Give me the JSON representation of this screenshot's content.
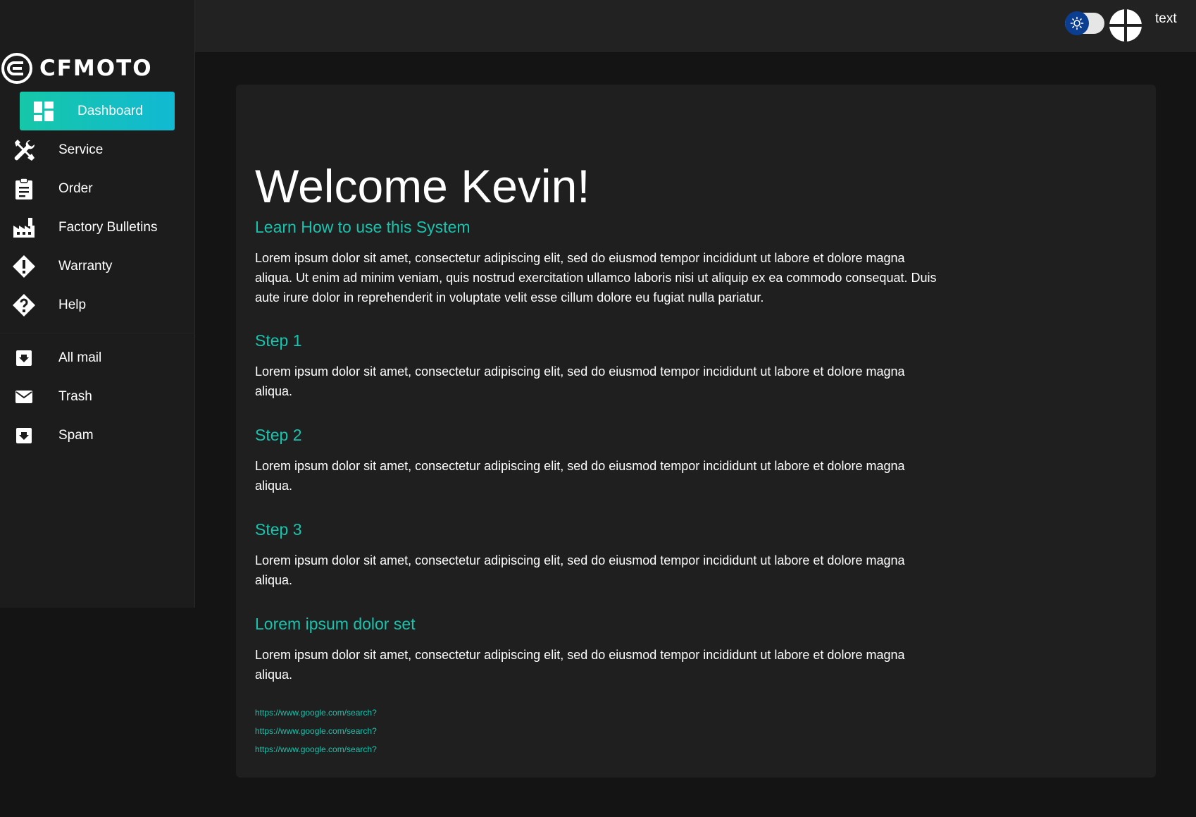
{
  "brand": {
    "name": "CFMOTO"
  },
  "sidebar": {
    "items": [
      {
        "label": "Dashboard",
        "icon": "dashboard-icon",
        "active": true
      },
      {
        "label": "Service",
        "icon": "tools-icon"
      },
      {
        "label": "Order",
        "icon": "clipboard-icon"
      },
      {
        "label": "Factory Bulletins",
        "icon": "factory-icon"
      },
      {
        "label": "Warranty",
        "icon": "warning-diamond-icon"
      },
      {
        "label": "Help",
        "icon": "help-diamond-icon"
      }
    ],
    "mail_items": [
      {
        "label": "All mail",
        "icon": "inbox-icon"
      },
      {
        "label": "Trash",
        "icon": "mail-icon"
      },
      {
        "label": "Spam",
        "icon": "inbox-icon"
      }
    ]
  },
  "topbar": {
    "theme_toggle_icon": "sun-icon",
    "avatar_icon": "avatar-icon",
    "user_text": "text"
  },
  "main": {
    "welcome": "Welcome Kevin!",
    "intro_heading": "Learn How to use this System",
    "intro_text": "Lorem ipsum dolor sit amet, consectetur adipiscing elit, sed do eiusmod tempor incididunt ut labore et dolore magna aliqua. Ut enim ad minim veniam, quis nostrud exercitation ullamco laboris nisi ut aliquip ex ea commodo consequat. Duis aute irure dolor in reprehenderit in voluptate velit esse cillum dolore eu fugiat nulla pariatur.",
    "sections": [
      {
        "heading": "Step 1",
        "text": "Lorem ipsum dolor sit amet, consectetur adipiscing elit, sed do eiusmod tempor incididunt ut labore et dolore magna aliqua."
      },
      {
        "heading": "Step 2",
        "text": "Lorem ipsum dolor sit amet, consectetur adipiscing elit, sed do eiusmod tempor incididunt ut labore et dolore magna aliqua."
      },
      {
        "heading": "Step 3",
        "text": "Lorem ipsum dolor sit amet, consectetur adipiscing elit, sed do eiusmod tempor incididunt ut labore et dolore magna aliqua."
      },
      {
        "heading": "Lorem ipsum dolor set",
        "text": "Lorem ipsum dolor sit amet, consectetur adipiscing elit, sed do eiusmod tempor incididunt ut labore et dolore magna aliqua."
      }
    ],
    "links": [
      "https://www.google.com/search?",
      "https://www.google.com/search?",
      "https://www.google.com/search?"
    ]
  },
  "colors": {
    "accent": "#19c3ad",
    "active_gradient_start": "#16c7a8",
    "active_gradient_end": "#12b9d3",
    "toggle_knob": "#0b3d91",
    "background": "#141414",
    "card": "#1f1f1f"
  }
}
